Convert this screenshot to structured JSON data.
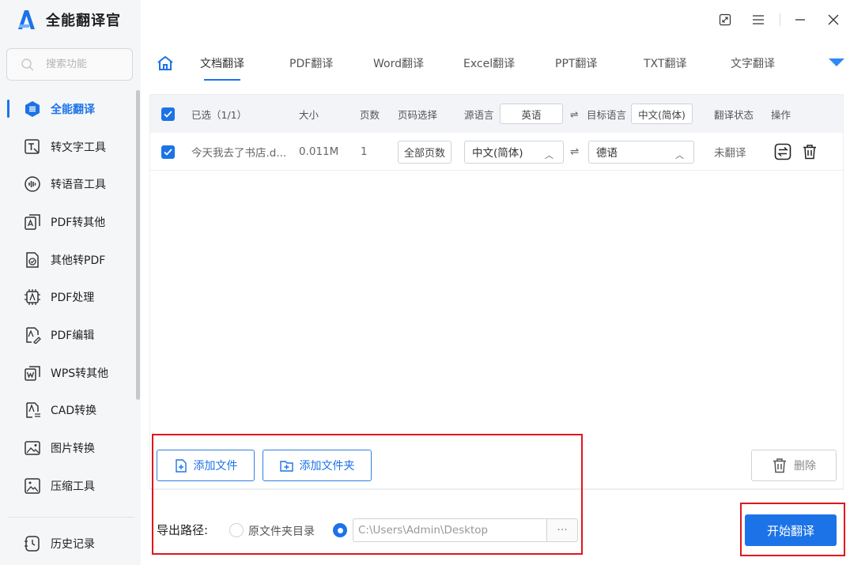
{
  "app": {
    "title": "全能翻译官"
  },
  "search": {
    "placeholder": "搜索功能"
  },
  "sidebar": {
    "items": [
      {
        "label": "全能翻译",
        "icon": "translate-icon",
        "active": true
      },
      {
        "label": "转文字工具",
        "icon": "text-tool-icon"
      },
      {
        "label": "转语音工具",
        "icon": "voice-icon"
      },
      {
        "label": "PDF转其他",
        "icon": "pdf-convert-icon"
      },
      {
        "label": "其他转PDF",
        "icon": "to-pdf-icon"
      },
      {
        "label": "PDF处理",
        "icon": "pdf-process-icon"
      },
      {
        "label": "PDF编辑",
        "icon": "pdf-edit-icon"
      },
      {
        "label": "WPS转其他",
        "icon": "wps-icon"
      },
      {
        "label": "CAD转换",
        "icon": "cad-icon"
      },
      {
        "label": "图片转换",
        "icon": "image-icon"
      },
      {
        "label": "压缩工具",
        "icon": "compress-icon"
      }
    ],
    "history": {
      "label": "历史记录",
      "icon": "history-icon"
    }
  },
  "tabs": [
    {
      "label": "文档翻译",
      "active": true
    },
    {
      "label": "PDF翻译"
    },
    {
      "label": "Word翻译"
    },
    {
      "label": "Excel翻译"
    },
    {
      "label": "PPT翻译"
    },
    {
      "label": "TXT翻译"
    },
    {
      "label": "文字翻译"
    }
  ],
  "table": {
    "header": {
      "selected": "已选（1/1）",
      "size": "大小",
      "pages": "页数",
      "page_select": "页码选择",
      "source_lang": "源语言",
      "source_lang_value": "英语",
      "target_lang": "目标语言",
      "target_lang_value": "中文(简体)",
      "status": "翻译状态",
      "action": "操作"
    },
    "rows": [
      {
        "filename": "今天我去了书店.d...",
        "size": "0.011M",
        "pages": "1",
        "page_select": "全部页数",
        "source_lang": "中文(简体)",
        "target_lang": "德语",
        "status": "未翻译"
      }
    ]
  },
  "buttons": {
    "add_file": "添加文件",
    "add_folder": "添加文件夹",
    "delete": "删除",
    "start": "开始翻译"
  },
  "export": {
    "label": "导出路径:",
    "option_original": "原文件夹目录",
    "path": "C:\\Users\\Admin\\Desktop",
    "browse": "···"
  },
  "colors": {
    "accent": "#1c73e8",
    "highlight": "#e3151c"
  }
}
